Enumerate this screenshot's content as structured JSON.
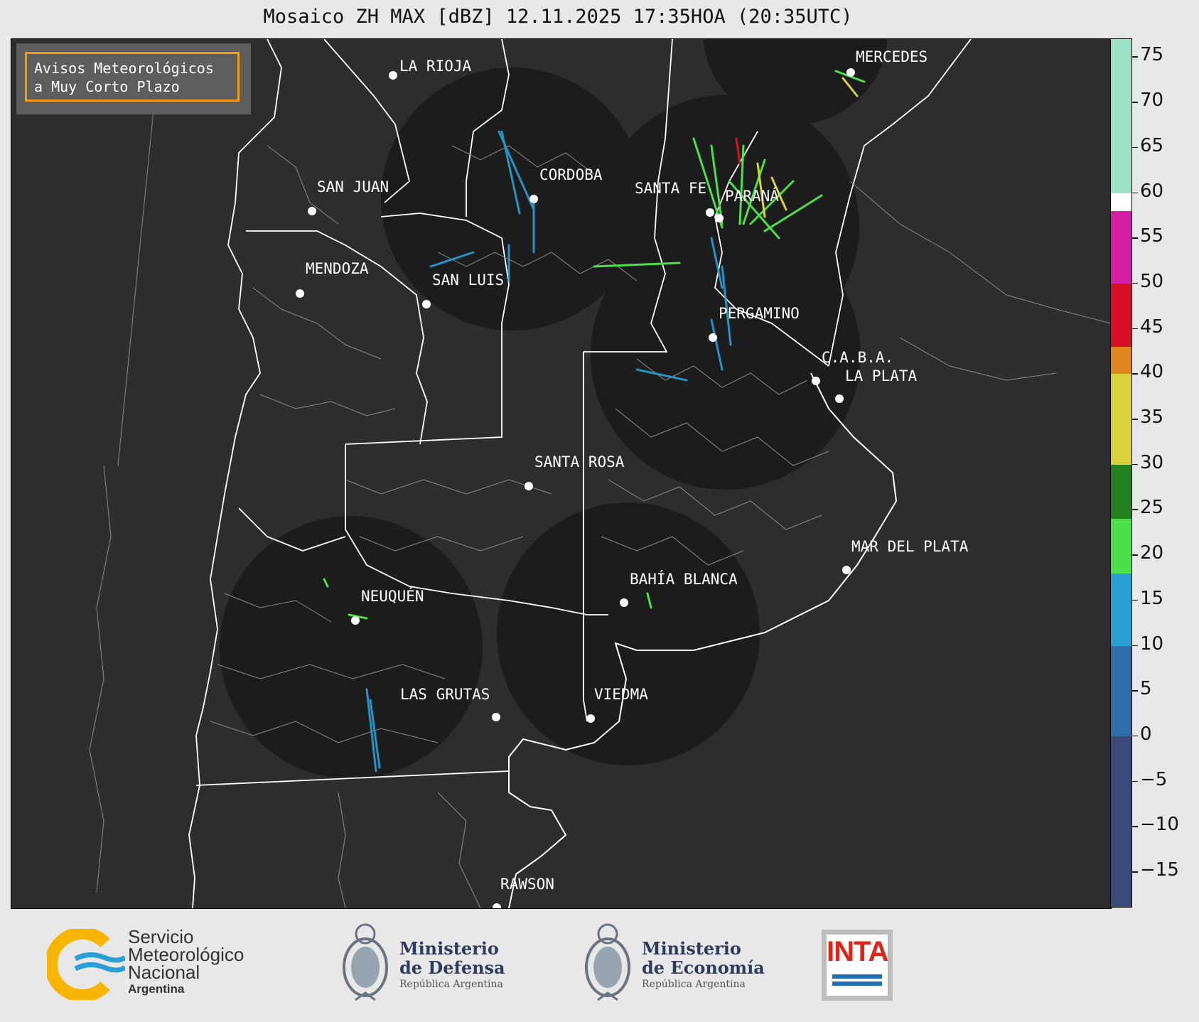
{
  "title": "Mosaico ZH MAX [dBZ] 12.11.2025 17:35HOA (20:35UTC)",
  "notice": {
    "line1": "Avisos Meteorológicos",
    "line2": "a Muy Corto Plazo"
  },
  "cities": [
    {
      "name": "LA RIOJA"
    },
    {
      "name": "CORDOBA"
    },
    {
      "name": "SAN JUAN"
    },
    {
      "name": "SANTA FE"
    },
    {
      "name": "PARANÁ"
    },
    {
      "name": "MENDOZA"
    },
    {
      "name": "SAN LUIS"
    },
    {
      "name": "PERGAMINO"
    },
    {
      "name": "C.A.B.A."
    },
    {
      "name": "LA PLATA"
    },
    {
      "name": "SANTA ROSA"
    },
    {
      "name": "MAR DEL PLATA"
    },
    {
      "name": "BAHÍA BLANCA"
    },
    {
      "name": "NEUQUÉN"
    },
    {
      "name": "LAS GRUTAS"
    },
    {
      "name": "VIEDMA"
    },
    {
      "name": "RAWSON"
    },
    {
      "name": "MERCEDES"
    }
  ],
  "colorbar": {
    "unit": "dBZ",
    "range": [
      -19,
      77
    ],
    "ticks": [
      "75",
      "70",
      "65",
      "60",
      "55",
      "50",
      "45",
      "40",
      "35",
      "30",
      "25",
      "20",
      "15",
      "10",
      "5",
      "0",
      "−5",
      "−10",
      "−15"
    ],
    "tick_values": [
      75,
      70,
      65,
      60,
      55,
      50,
      45,
      40,
      35,
      30,
      25,
      20,
      15,
      10,
      5,
      0,
      -5,
      -10,
      -15
    ],
    "colors": [
      {
        "from": -19,
        "to": 0,
        "color": "#3a4a7a"
      },
      {
        "from": 0,
        "to": 10,
        "color": "#2f6ea8"
      },
      {
        "from": 10,
        "to": 18,
        "color": "#2a9fd6"
      },
      {
        "from": 18,
        "to": 24,
        "color": "#4ee04a"
      },
      {
        "from": 24,
        "to": 30,
        "color": "#23801f"
      },
      {
        "from": 30,
        "to": 40,
        "color": "#d9d23a"
      },
      {
        "from": 40,
        "to": 43,
        "color": "#e0861c"
      },
      {
        "from": 43,
        "to": 50,
        "color": "#d81026"
      },
      {
        "from": 50,
        "to": 58,
        "color": "#d51fa6"
      },
      {
        "from": 58,
        "to": 60,
        "color": "#ffffff"
      },
      {
        "from": 60,
        "to": 77,
        "color": "#9de3c8"
      }
    ]
  },
  "logos": {
    "smn": {
      "line1": "Servicio",
      "line2": "Meteorológico",
      "line3": "Nacional",
      "line4": "Argentina"
    },
    "defensa": {
      "line1": "Ministerio",
      "line2": "de Defensa",
      "line3": "República Argentina"
    },
    "economia": {
      "line1": "Ministerio",
      "line2": "de Economía",
      "line3": "República Argentina"
    },
    "inta": {
      "text": "INTA"
    }
  }
}
